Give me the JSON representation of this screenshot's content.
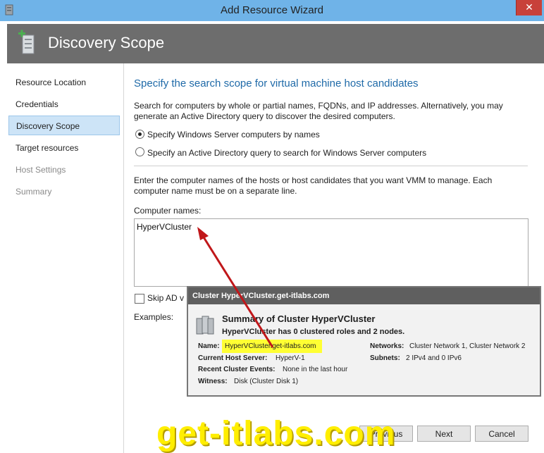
{
  "window": {
    "title": "Add Resource Wizard",
    "close_glyph": "✕"
  },
  "header": {
    "title": "Discovery Scope",
    "icon": "server-add-icon"
  },
  "sidebar": {
    "items": [
      {
        "label": "Resource Location",
        "state": "normal"
      },
      {
        "label": "Credentials",
        "state": "normal"
      },
      {
        "label": "Discovery Scope",
        "state": "active"
      },
      {
        "label": "Target resources",
        "state": "normal"
      },
      {
        "label": "Host Settings",
        "state": "disabled"
      },
      {
        "label": "Summary",
        "state": "disabled"
      }
    ]
  },
  "main": {
    "heading": "Specify the search scope for virtual machine host candidates",
    "description_line1": "Search for computers by whole or partial names, FQDNs, and IP addresses. Alternatively, you may",
    "description_line2": "generate an Active Directory query to discover the desired computers.",
    "radio_names": "Specify Windows Server computers by names",
    "radio_ad": "Specify an Active Directory query to search for Windows Server computers",
    "instructions_line1": "Enter the computer names of the hosts or host candidates that you want VMM to manage. Each",
    "instructions_line2": "computer name must be on a separate line.",
    "computer_names_label": "Computer names:",
    "computer_names_value": "HyperVCluster",
    "skip_ad_label": "Skip AD v",
    "examples_label": "Examples:"
  },
  "tooltip": {
    "header": "Cluster HyperVCluster.get-itlabs.com",
    "summary_title": "Summary of Cluster HyperVCluster",
    "summary_sub": "HyperVCluster has 0 clustered roles and 2 nodes.",
    "name_label": "Name:",
    "name_value": "HyperVCluster.get-itlabs.com",
    "host_label": "Current Host Server:",
    "host_value": "HyperV-1",
    "events_label": "Recent Cluster Events:",
    "events_value": "None in the last hour",
    "witness_label": "Witness:",
    "witness_value": "Disk (Cluster Disk 1)",
    "networks_label": "Networks:",
    "networks_value": "Cluster Network 1, Cluster Network 2",
    "subnets_label": "Subnets:",
    "subnets_value": "2 IPv4 and 0 IPv6"
  },
  "buttons": {
    "previous": "Previous",
    "next": "Next",
    "cancel": "Cancel"
  },
  "watermark": "get-itlabs.com",
  "colors": {
    "accent_blue": "#1f6aa8",
    "titlebar": "#6fb3e8",
    "highlight": "#ffff33",
    "arrow": "#c0171a",
    "watermark": "#ffee00"
  }
}
